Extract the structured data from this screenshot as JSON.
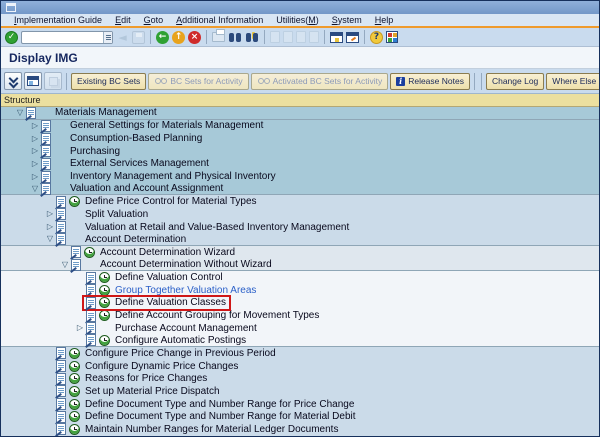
{
  "title": "Display IMG",
  "menubar": {
    "items": [
      {
        "label": "Implementation Guide",
        "u": 0
      },
      {
        "label": "Edit",
        "u": 0
      },
      {
        "label": "Goto",
        "u": 0
      },
      {
        "label": "Additional Information",
        "u": 0
      },
      {
        "label": "Utilities(M)",
        "u": 10
      },
      {
        "label": "System",
        "u": 0
      },
      {
        "label": "Help",
        "u": 0
      }
    ]
  },
  "toolbar": {
    "command_value": "",
    "command_placeholder": "",
    "icons": [
      {
        "name": "enter-icon",
        "type": "btn",
        "glyph": "check"
      },
      {
        "name": "command-field",
        "type": "field"
      },
      {
        "name": "back-triangle-icon",
        "type": "btn",
        "glyph": "tri-left",
        "disabled": true
      },
      {
        "name": "save-icon",
        "type": "btn",
        "glyph": "disk",
        "disabled": true
      },
      {
        "type": "sep"
      },
      {
        "name": "back-icon",
        "type": "btn",
        "glyph": "circle-left"
      },
      {
        "name": "exit-icon",
        "type": "btn",
        "glyph": "circle-up"
      },
      {
        "name": "cancel-icon",
        "type": "btn",
        "glyph": "circle-x"
      },
      {
        "type": "sep"
      },
      {
        "name": "print-icon",
        "type": "btn",
        "glyph": "printer"
      },
      {
        "name": "find-icon",
        "type": "btn",
        "glyph": "binoculars"
      },
      {
        "name": "find-next-icon",
        "type": "btn",
        "glyph": "binoculars-plus"
      },
      {
        "type": "sep"
      },
      {
        "name": "first-page-icon",
        "type": "btn",
        "glyph": "page",
        "disabled": true
      },
      {
        "name": "page-up-icon",
        "type": "btn",
        "glyph": "page",
        "disabled": true
      },
      {
        "name": "page-down-icon",
        "type": "btn",
        "glyph": "page",
        "disabled": true
      },
      {
        "name": "last-page-icon",
        "type": "btn",
        "glyph": "page",
        "disabled": true
      },
      {
        "type": "sep"
      },
      {
        "name": "new-session-icon",
        "type": "btn",
        "glyph": "window-star"
      },
      {
        "name": "create-shortcut-icon",
        "type": "btn",
        "glyph": "window-arrow"
      },
      {
        "type": "sep"
      },
      {
        "name": "help-icon",
        "type": "btn",
        "glyph": "help"
      },
      {
        "name": "customize-layout-icon",
        "type": "btn",
        "glyph": "grid"
      }
    ]
  },
  "app_toolbar": {
    "icon_buttons": [
      {
        "name": "expand-chevrons-icon",
        "glyph": "chevrons"
      },
      {
        "name": "display-options-icon",
        "glyph": "miniwin"
      },
      {
        "name": "copy-icon",
        "glyph": "copy",
        "disabled": true
      }
    ],
    "buttons": [
      {
        "name": "existing-bc-sets-button",
        "label": "Existing BC Sets",
        "enabled": true
      },
      {
        "name": "bc-sets-for-activity-button",
        "label": "BC Sets for Activity",
        "enabled": false,
        "icon": "glasses"
      },
      {
        "name": "activated-bc-sets-for-activity-button",
        "label": "Activated BC Sets for Activity",
        "enabled": false,
        "icon": "glasses"
      },
      {
        "name": "release-notes-button",
        "label": "Release Notes",
        "enabled": true,
        "icon": "info"
      },
      {
        "sep": 2
      },
      {
        "name": "change-log-button",
        "label": "Change Log",
        "enabled": true
      },
      {
        "name": "where-else-used-button",
        "label": "Where Else Used",
        "enabled": true
      }
    ],
    "info_icon_glyph": "i"
  },
  "structure": {
    "header": "Structure"
  },
  "tree": {
    "rows": [
      {
        "label": "Materials Management",
        "level": 0,
        "expander": "open",
        "activity": false,
        "band": "b1",
        "sep": true
      },
      {
        "label": "General Settings for Materials Management",
        "level": 1,
        "expander": "closed",
        "activity": false,
        "band": "b1"
      },
      {
        "label": "Consumption-Based Planning",
        "level": 1,
        "expander": "closed",
        "activity": false,
        "band": "b1"
      },
      {
        "label": "Purchasing",
        "level": 1,
        "expander": "closed",
        "activity": false,
        "band": "b1"
      },
      {
        "label": "External Services Management",
        "level": 1,
        "expander": "closed",
        "activity": false,
        "band": "b1"
      },
      {
        "label": "Inventory Management and Physical Inventory",
        "level": 1,
        "expander": "closed",
        "activity": false,
        "band": "b1"
      },
      {
        "label": "Valuation and Account Assignment",
        "level": 1,
        "expander": "open",
        "activity": false,
        "band": "b1",
        "sep": true
      },
      {
        "label": "Define Price Control for Material Types",
        "level": 2,
        "expander": null,
        "activity": true,
        "band": "b2"
      },
      {
        "label": "Split Valuation",
        "level": 2,
        "expander": "closed",
        "activity": false,
        "band": "b2"
      },
      {
        "label": "Valuation at Retail and Value-Based Inventory Management",
        "level": 2,
        "expander": "closed",
        "activity": false,
        "band": "b2"
      },
      {
        "label": "Account Determination",
        "level": 2,
        "expander": "open",
        "activity": false,
        "band": "b2",
        "sep": true
      },
      {
        "label": "Account Determination Wizard",
        "level": 3,
        "expander": null,
        "activity": true,
        "band": "b3"
      },
      {
        "label": "Account Determination Without Wizard",
        "level": 3,
        "expander": "open",
        "activity": false,
        "band": "b3",
        "sep": true
      },
      {
        "label": "Define Valuation Control",
        "level": 4,
        "expander": null,
        "activity": true,
        "band": "b4"
      },
      {
        "label": "Group Together Valuation Areas",
        "level": 4,
        "expander": null,
        "activity": true,
        "band": "b4",
        "link": true
      },
      {
        "label": "Define Valuation Classes",
        "level": 4,
        "expander": null,
        "activity": true,
        "band": "b4",
        "boxed": true
      },
      {
        "label": "Define Account Grouping for Movement Types",
        "level": 4,
        "expander": null,
        "activity": true,
        "band": "b4"
      },
      {
        "label": "Purchase Account Management",
        "level": 4,
        "expander": "closed",
        "activity": false,
        "band": "b4"
      },
      {
        "label": "Configure Automatic Postings",
        "level": 4,
        "expander": null,
        "activity": true,
        "band": "b4",
        "sep": true
      },
      {
        "label": "Configure Price Change in Previous Period",
        "level": 2,
        "expander": null,
        "activity": true,
        "band": "b2"
      },
      {
        "label": "Configure Dynamic Price Changes",
        "level": 2,
        "expander": null,
        "activity": true,
        "band": "b2"
      },
      {
        "label": "Reasons for Price Changes",
        "level": 2,
        "expander": null,
        "activity": true,
        "band": "b2"
      },
      {
        "label": "Set up Material Price Dispatch",
        "level": 2,
        "expander": null,
        "activity": true,
        "band": "b2"
      },
      {
        "label": "Define Document Type and Number Range for Price Change",
        "level": 2,
        "expander": null,
        "activity": true,
        "band": "b2"
      },
      {
        "label": "Define Document Type and Number Range for Material Debit",
        "level": 2,
        "expander": null,
        "activity": true,
        "band": "b2"
      },
      {
        "label": "Maintain Number Ranges for Material Ledger Documents",
        "level": 2,
        "expander": null,
        "activity": true,
        "band": "b2"
      }
    ]
  },
  "colors": {
    "titlebar_blue": "#7397c8",
    "menubar_bg": "#d9e6f4",
    "orange_rule": "#ef9b2d",
    "toolbar_bg": "#c9dbee",
    "title_row_bg": "#f2f6fa",
    "title_text": "#16275f",
    "structure_bg": "#ebdf9f",
    "band1": "#a7c9d8",
    "band2": "#cbdbe9",
    "band3": "#dfe7ee",
    "band4": "#f2f5f9",
    "band_sep": "#8fa6b6",
    "tree_text": "#08081c",
    "link_blue": "#2a5fc8",
    "red_box": "#cf1717",
    "green_ok": "#2fa133",
    "exit_yellow": "#e8a31d",
    "cancel_red": "#cf2b2b"
  }
}
